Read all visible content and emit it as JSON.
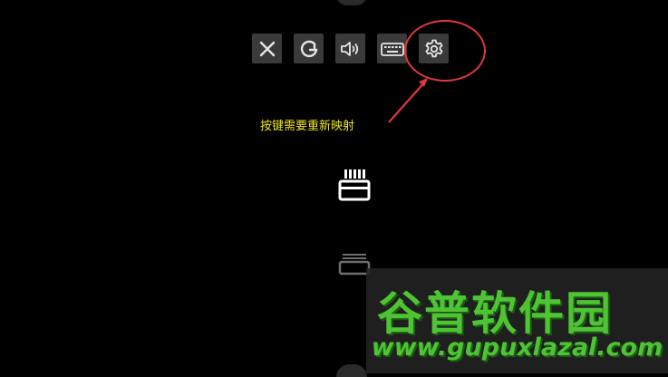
{
  "toolbar": {
    "buttons": [
      {
        "name": "close-button",
        "icon": "close-icon"
      },
      {
        "name": "refresh-button",
        "icon": "refresh-icon"
      },
      {
        "name": "volume-button",
        "icon": "volume-icon"
      },
      {
        "name": "keyboard-button",
        "icon": "keyboard-icon"
      },
      {
        "name": "settings-button",
        "icon": "gear-icon"
      }
    ]
  },
  "annotation": {
    "text": "按键需要重新映射",
    "text_color": "#f1e51c",
    "mark_color": "#e0383e"
  },
  "watermark": {
    "logo": "谷普软件园",
    "url": "www.gupuxlazal.com",
    "color": "#4fc335"
  }
}
